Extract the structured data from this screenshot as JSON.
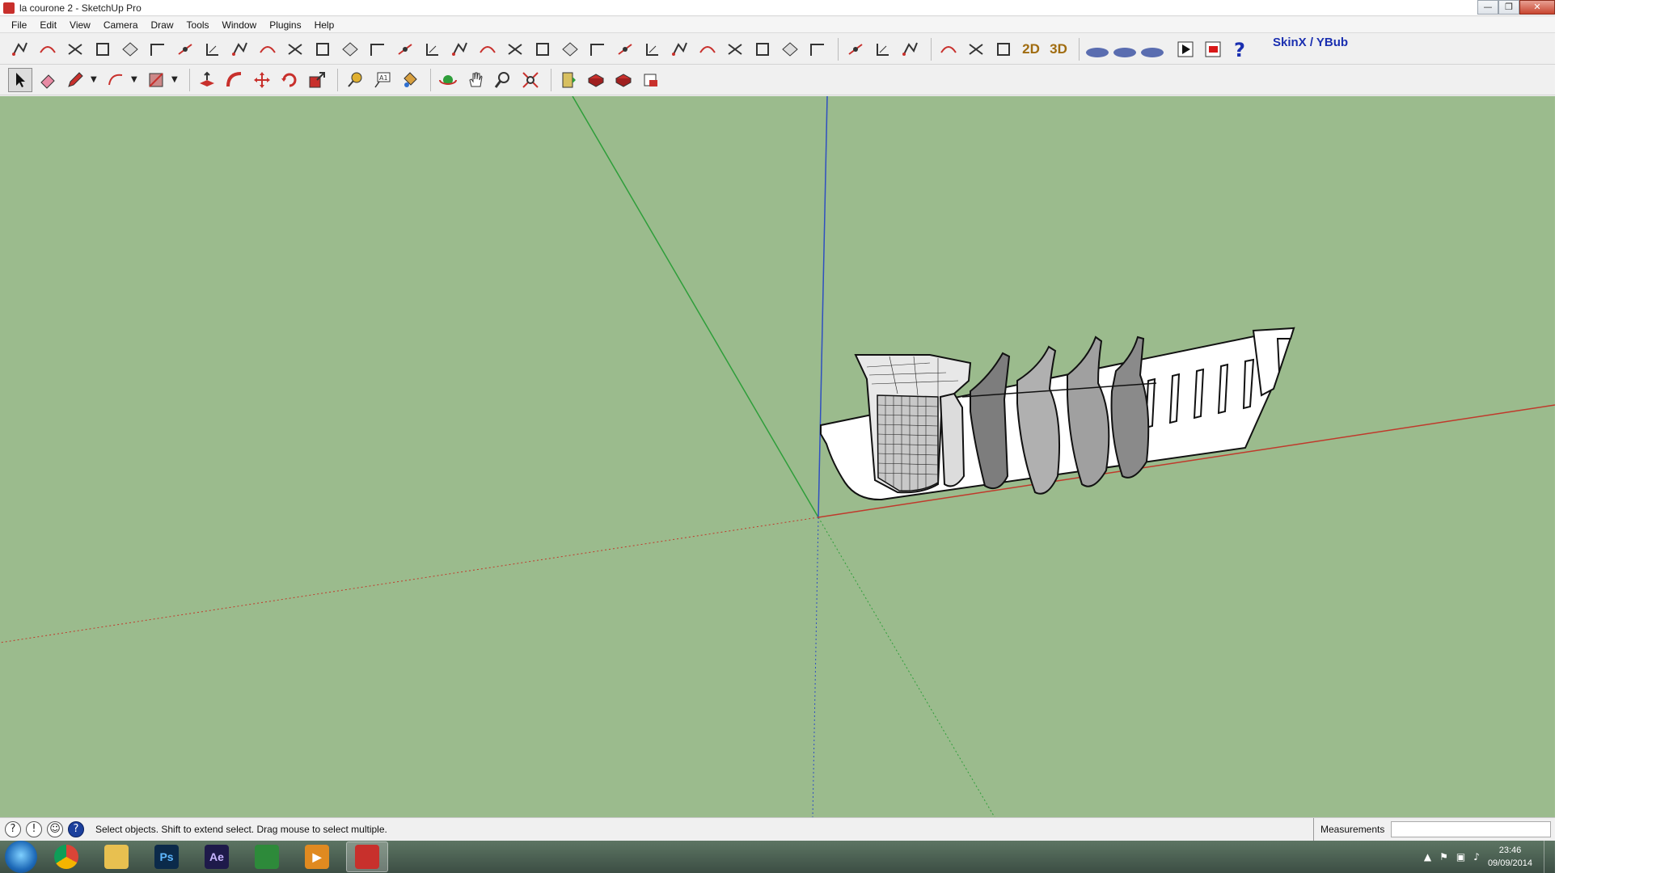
{
  "window": {
    "title": "la courone 2 - SketchUp Pro",
    "buttons": {
      "minimize": "—",
      "maximize": "❐",
      "close": "✕"
    }
  },
  "menu": [
    "File",
    "Edit",
    "View",
    "Camera",
    "Draw",
    "Tools",
    "Window",
    "Plugins",
    "Help"
  ],
  "toolbar1": {
    "count_icons": 38,
    "label_2d": "2D",
    "label_3d": "3D",
    "skin_label": "SkinX / YBub"
  },
  "toolbar2": {
    "tools": [
      "select",
      "eraser",
      "pencil",
      "arc",
      "rectangle",
      "push-pull",
      "follow-me",
      "move",
      "rotate",
      "scale",
      "tape-measure",
      "text",
      "paint-bucket",
      "orbit",
      "pan",
      "zoom",
      "zoom-extents",
      "section-plane",
      "component-1",
      "component-2",
      "component-3"
    ]
  },
  "status": {
    "text": "Select objects. Shift to extend select. Drag mouse to select multiple.",
    "measurements_label": "Measurements",
    "measurements_value": ""
  },
  "taskbar": {
    "apps": [
      "Windows",
      "Chrome",
      "Explorer",
      "Ps",
      "Ae",
      "Sketch",
      "Media",
      "SketchUp"
    ],
    "time": "23:46",
    "date": "09/09/2014"
  },
  "colors": {
    "viewport_bg": "#9bbb8d",
    "axis_red": "#c0392b",
    "axis_green": "#2e9e3a",
    "axis_blue": "#2f4fc0"
  }
}
